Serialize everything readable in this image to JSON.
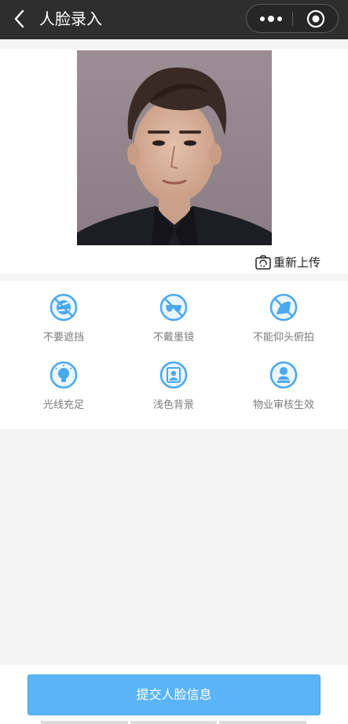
{
  "nav": {
    "title": "人脸录入",
    "back_icon": "chevron-left-icon",
    "more_icon": "more-dots-icon",
    "close_icon": "target-circle-icon"
  },
  "photo": {
    "subject": "portrait photo",
    "reupload_label": "重新上传",
    "reupload_icon": "camera-rotate-icon"
  },
  "tips": [
    {
      "icon": "no-cover-icon",
      "label": "不要遮挡"
    },
    {
      "icon": "no-sunglasses-icon",
      "label": "不戴墨镜"
    },
    {
      "icon": "no-tilt-icon",
      "label": "不能仰头俯拍"
    },
    {
      "icon": "lightbulb-icon",
      "label": "光线充足"
    },
    {
      "icon": "portrait-frame-icon",
      "label": "浅色背景"
    },
    {
      "icon": "user-stamp-icon",
      "label": "物业审核生效"
    }
  ],
  "submit_label": "提交人脸信息",
  "colors": {
    "nav_bg": "#2e2e2e",
    "accent": "#5ab4f6",
    "icon_blue": "#4aa8ee",
    "page_bg": "#f4f4f4"
  }
}
